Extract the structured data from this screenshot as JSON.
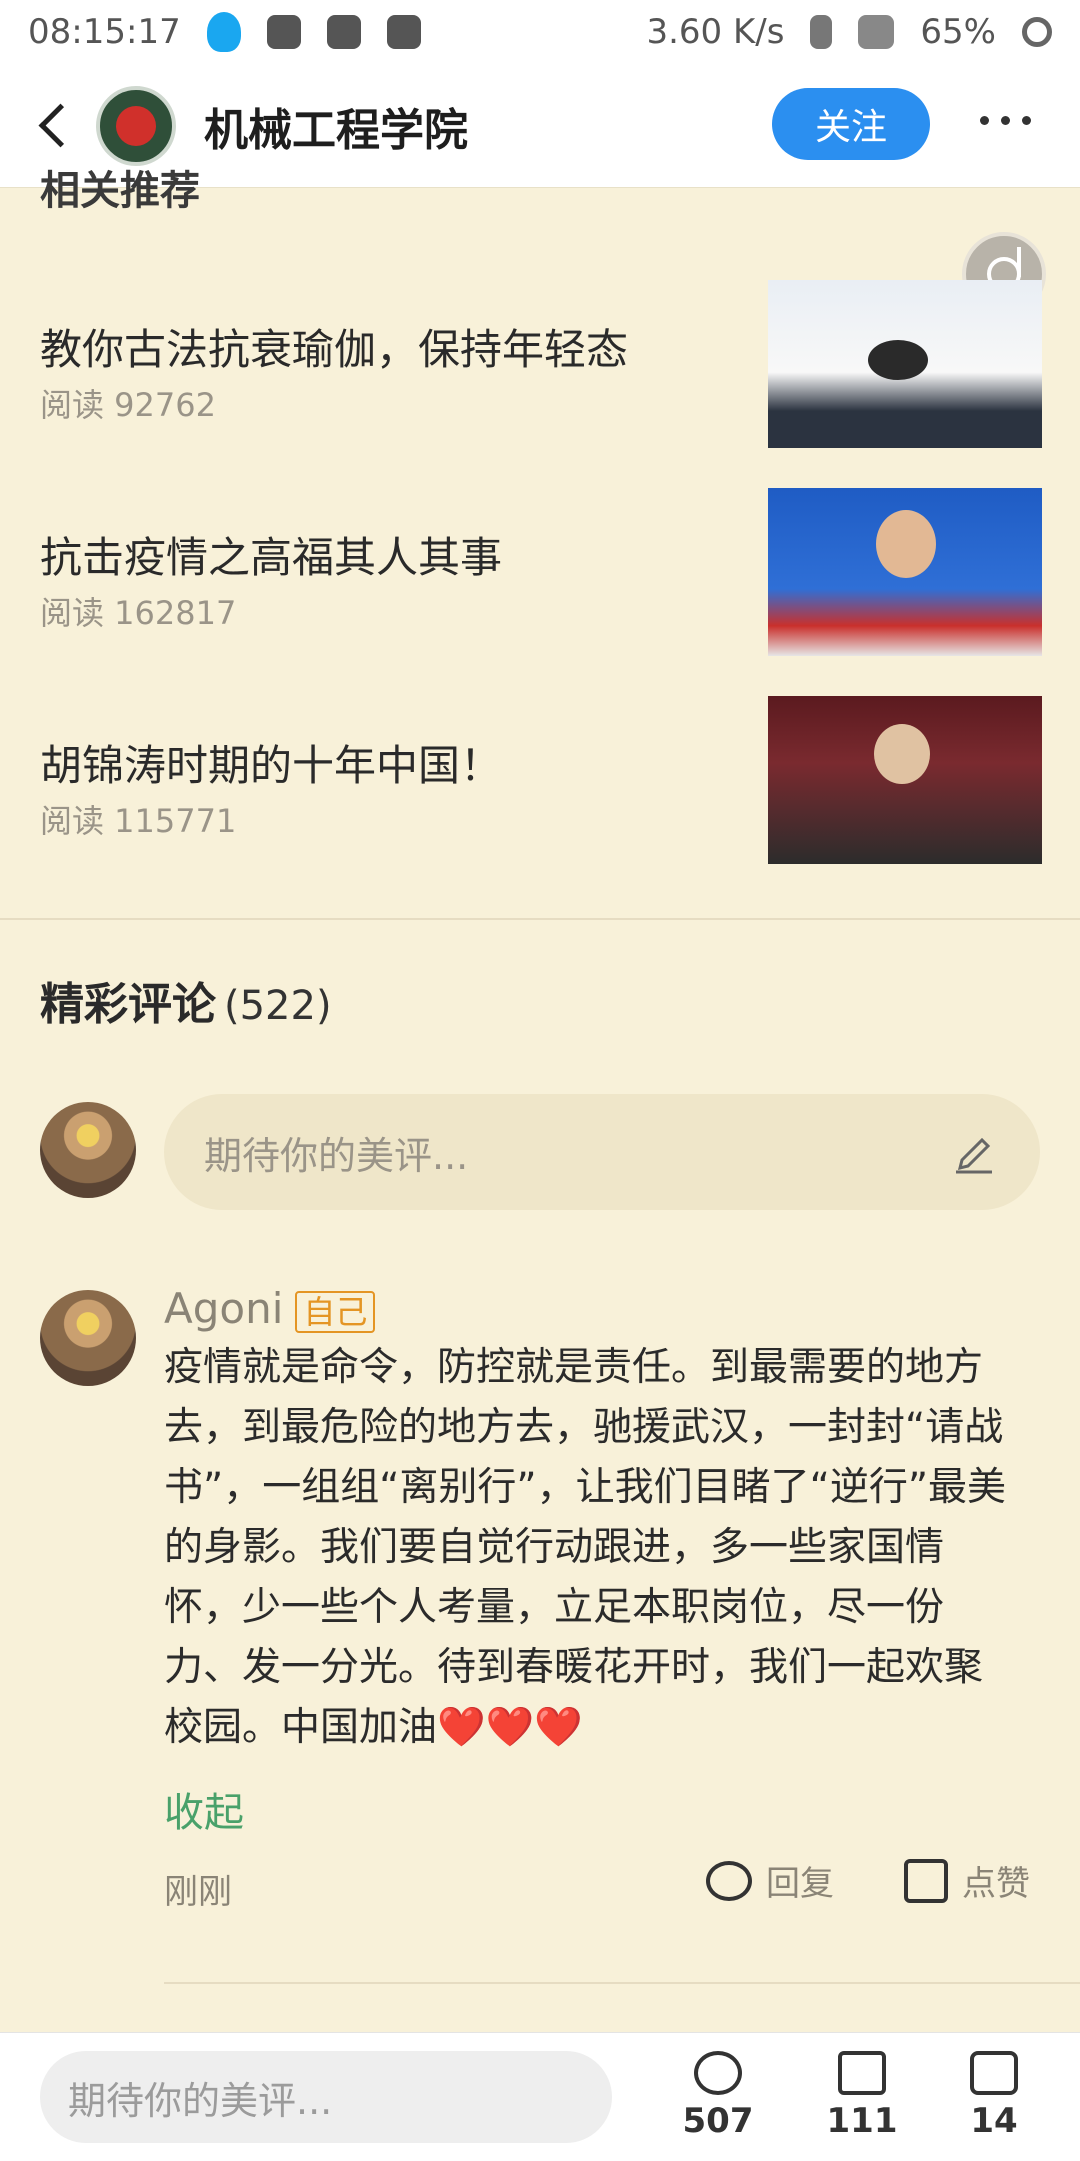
{
  "status_bar": {
    "time": "08:15:17",
    "net_speed": "3.60 K/s",
    "battery": "65%"
  },
  "header": {
    "title": "机械工程学院",
    "follow_label": "关注"
  },
  "related": {
    "heading_cut": "相关推荐",
    "articles": [
      {
        "title": "教你古法抗衰瑜伽，保持年轻态",
        "reads": "阅读 92762"
      },
      {
        "title": "抗击疫情之高福其人其事",
        "reads": "阅读 162817"
      },
      {
        "title": "胡锦涛时期的十年中国！",
        "reads": "阅读 115771"
      }
    ]
  },
  "comments": {
    "heading": "精彩评论",
    "count": "(522)",
    "input_placeholder": "期待你的美评...",
    "items": [
      {
        "author": "Agoni",
        "badge": "自己",
        "text": "疫情就是命令，防控就是责任。到最需要的地方去，到最危险的地方去，驰援武汉，一封封“请战书”，一组组“离别行”，让我们目睹了“逆行”最美的身影。我们要自觉行动跟进，多一些家国情怀，少一些个人考量，立足本职岗位，尽一份力、发一分光。待到春暖花开时，我们一起欢聚校园。中国加油❤️❤️❤️",
        "collapse_label": "收起",
        "time": "刚刚",
        "reply_label": "回复",
        "like_label": "点赞"
      }
    ]
  },
  "bottom_bar": {
    "input_placeholder": "期待你的美评...",
    "comment_count": "507",
    "like_count": "111",
    "share_count": "14"
  }
}
